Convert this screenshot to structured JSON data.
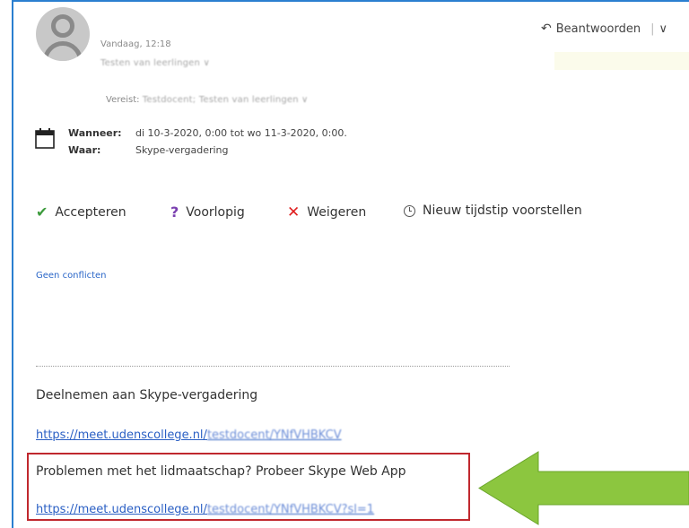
{
  "header": {
    "date_label": "Vandaag, 12:18",
    "sender_name": "Testen van leerlingen",
    "required_label": "Vereist:",
    "required_names": "Testdocent; Testen van leerlingen"
  },
  "toolbar": {
    "reply_label": "Beantwoorden",
    "reply_dropdown": "∨"
  },
  "event": {
    "when_label": "Wanneer:",
    "when_value": "di 10-3-2020, 0:00 tot wo 11-3-2020, 0:00.",
    "where_label": "Waar:",
    "where_value": "Skype-vergadering"
  },
  "actions": {
    "accept": "Accepteren",
    "tentative": "Voorlopig",
    "decline": "Weigeren",
    "propose": "Nieuw tijdstip voorstellen"
  },
  "status": {
    "conflicts": "Geen conflicten"
  },
  "body": {
    "join_title": "Deelnemen aan Skype-vergadering",
    "link1_base": "https://meet.udenscollege.nl/",
    "link1_tail": "testdocent/YNfVHBKCV",
    "problem_text": "Problemen met het lidmaatschap? Probeer Skype Web App",
    "link2_base": "https://meet.udenscollege.nl/",
    "link2_tail": "testdocent/YNfVHBKCV?sl=1"
  },
  "colors": {
    "highlight_border": "#c0282e",
    "arrow_fill": "#8cc63f",
    "link": "#2a5fc4"
  }
}
